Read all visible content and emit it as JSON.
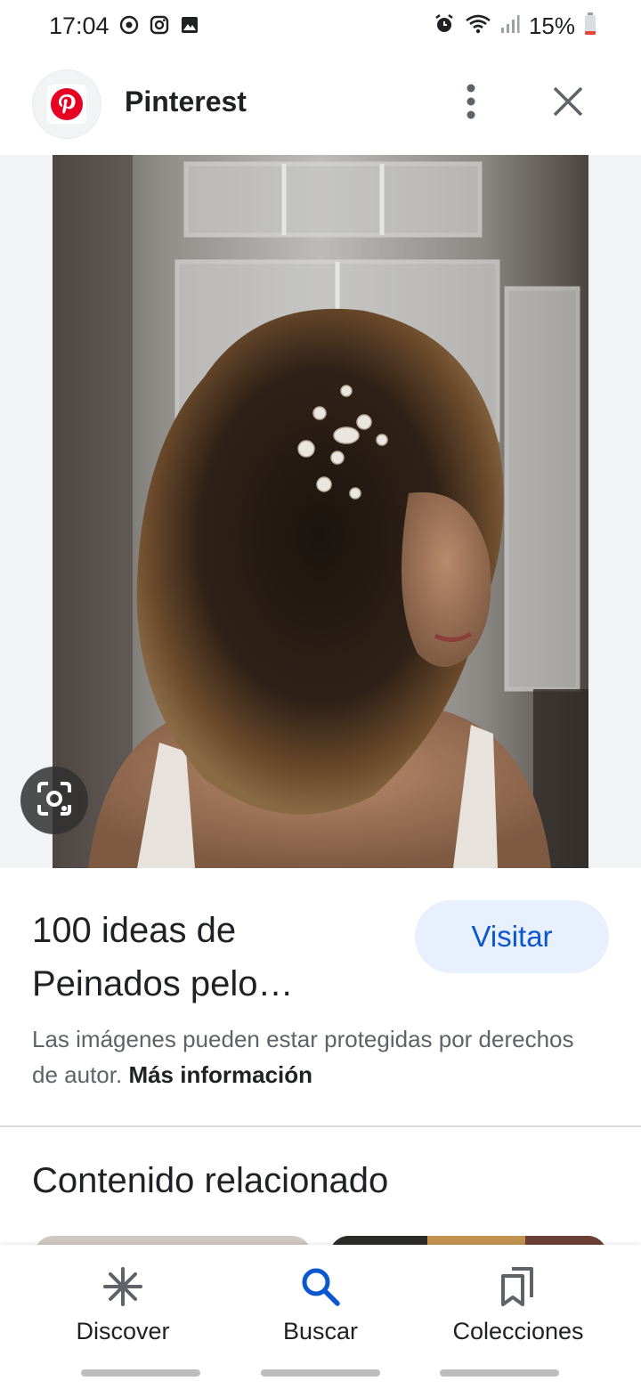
{
  "status_bar": {
    "time": "17:04",
    "battery": "15%",
    "left_icons": [
      "whatsapp-icon",
      "instagram-icon",
      "gallery-icon"
    ],
    "right_icons": [
      "alarm-icon",
      "wifi-icon",
      "signal-icon",
      "battery-icon"
    ]
  },
  "header": {
    "site_name": "Pinterest",
    "logo_icon": "pinterest-logo-icon",
    "brand_color": "#e60023"
  },
  "result": {
    "title": "100 ideas de Peinados pelo…",
    "visit_label": "Visitar",
    "copyright_text": "Las imágenes pueden estar protegidas por derechos de autor.",
    "more_info_label": "Más información"
  },
  "related": {
    "heading": "Contenido relacionado"
  },
  "bottom_nav": {
    "items": [
      {
        "label": "Discover",
        "icon": "asterisk-icon"
      },
      {
        "label": "Buscar",
        "icon": "search-icon",
        "active": true
      },
      {
        "label": "Colecciones",
        "icon": "bookmarks-icon"
      }
    ]
  },
  "colors": {
    "accent": "#0b57d0",
    "visit_bg": "#e8f0fe",
    "text": "#202124",
    "secondary_text": "#5f6368"
  }
}
